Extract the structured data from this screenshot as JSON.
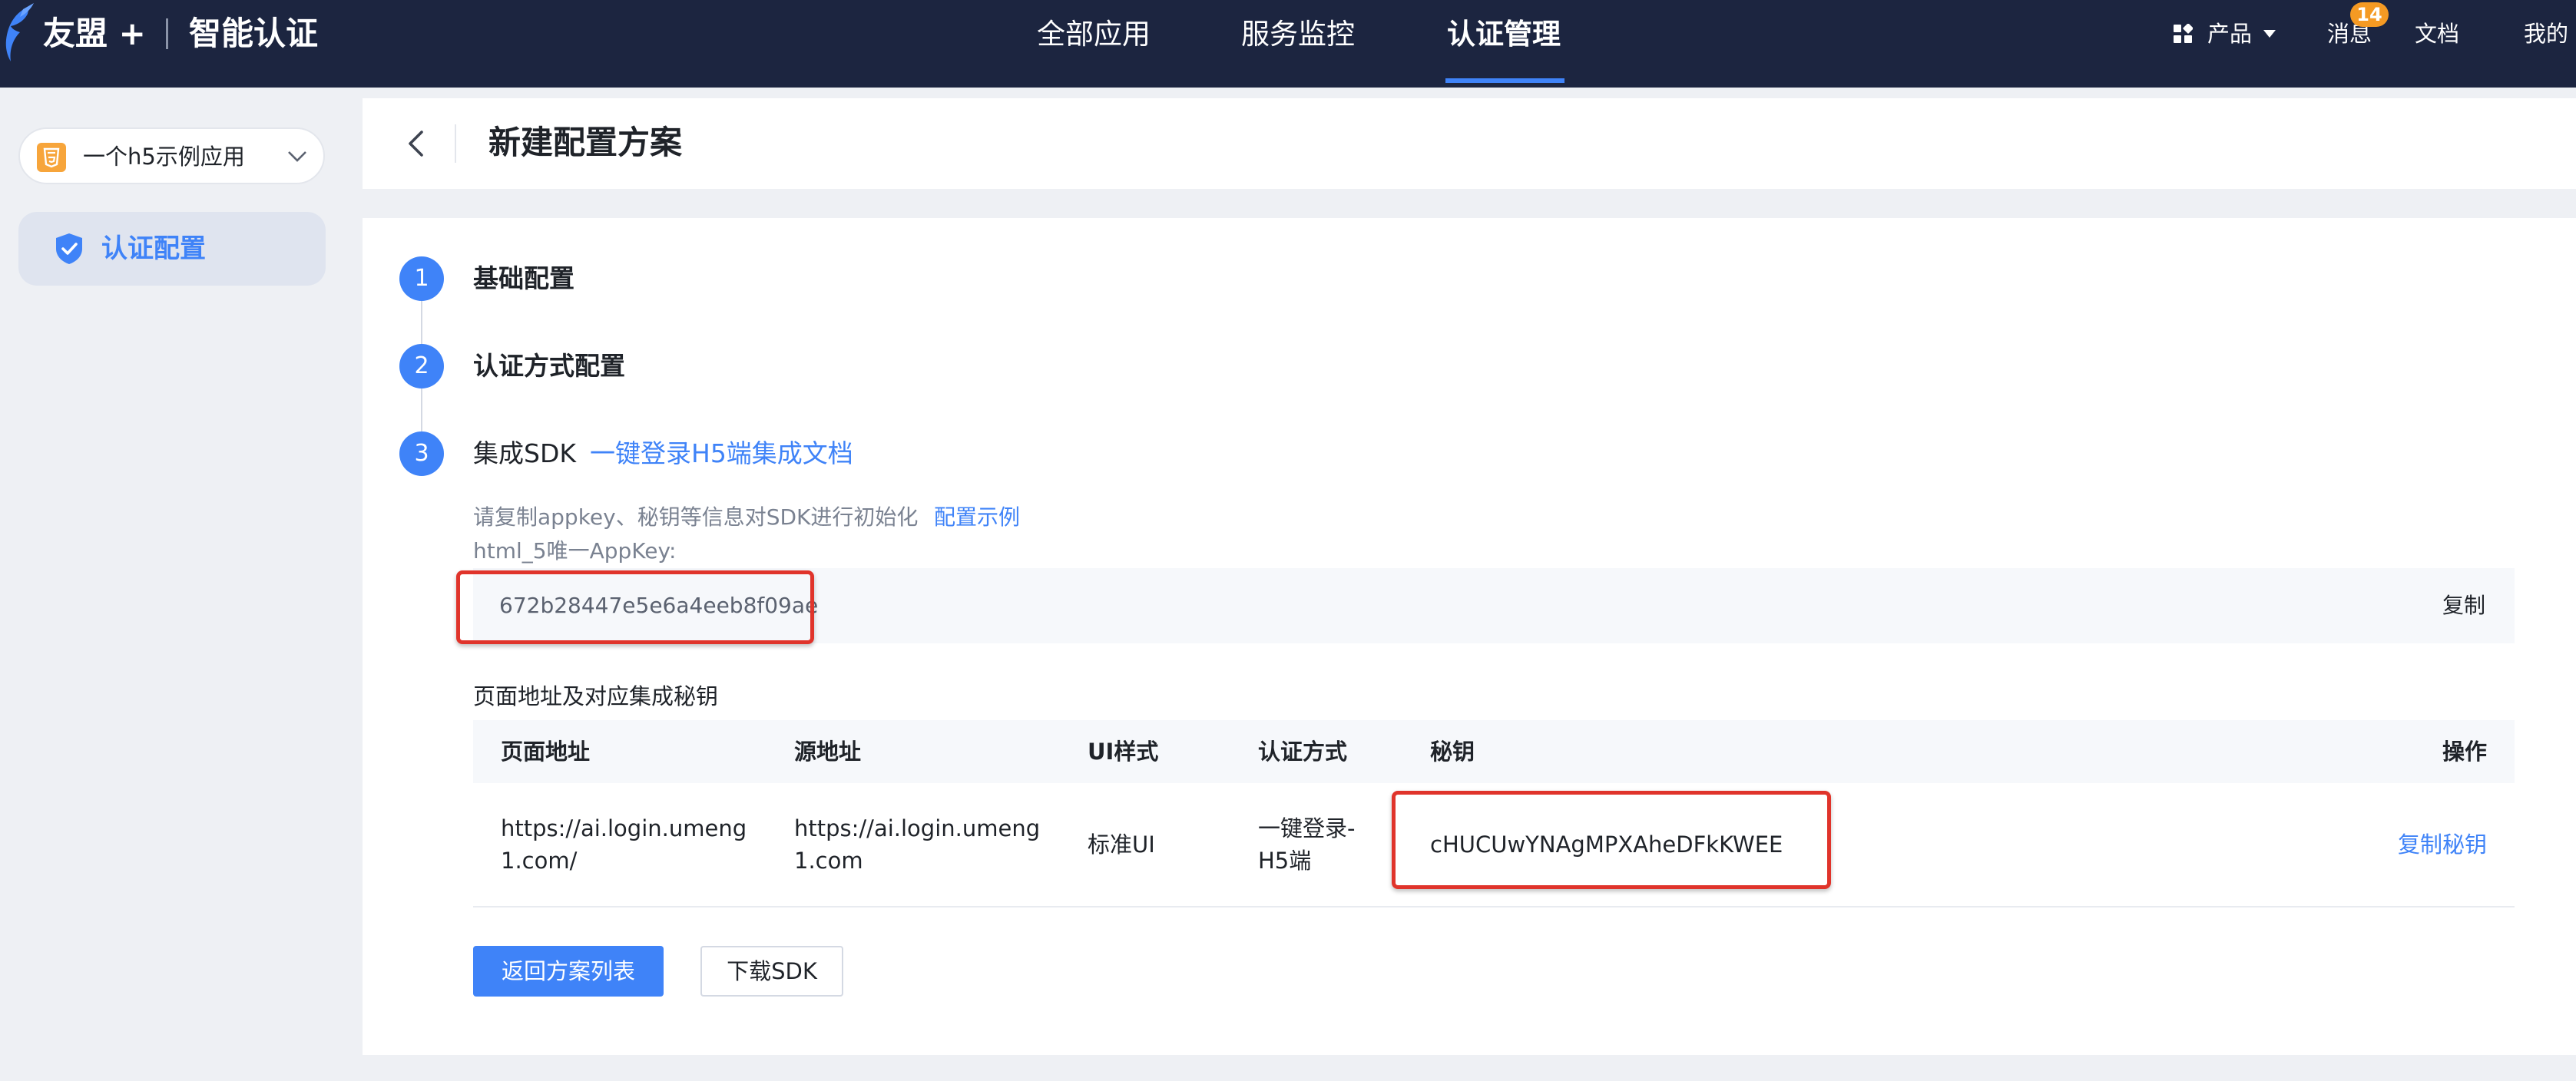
{
  "topnav": {
    "brand": "友盟 +",
    "product": "智能认证",
    "main_items": [
      {
        "label": "全部应用"
      },
      {
        "label": "服务监控"
      },
      {
        "label": "认证管理"
      }
    ],
    "util": {
      "product_label": "产品",
      "messages_label": "消息",
      "messages_badge": "14",
      "docs_label": "文档",
      "mine_label": "我的"
    }
  },
  "sidebar": {
    "app_select_value": "一个h5示例应用",
    "items": [
      {
        "label": "认证配置"
      }
    ]
  },
  "header": {
    "title": "新建配置方案"
  },
  "steps": [
    {
      "number": "1",
      "title": "基础配置"
    },
    {
      "number": "2",
      "title": "认证方式配置"
    },
    {
      "number": "3",
      "title": "集成SDK",
      "link": "一键登录H5端集成文档"
    }
  ],
  "sdk": {
    "hint": "请复制appkey、秘钥等信息对SDK进行初始化",
    "hint_link": "配置示例",
    "appkey_label": "html_5唯一AppKey:",
    "appkey_value": "672b28447e5e6a4eeb8f09ae",
    "copy_label": "复制",
    "section_label": "页面地址及对应集成秘钥",
    "table": {
      "headers": [
        "页面地址",
        "源地址",
        "UI样式",
        "认证方式",
        "秘钥",
        "操作"
      ],
      "rows": [
        {
          "page_url": "https://ai.login.umeng1.com/",
          "source_url": "https://ai.login.umeng1.com",
          "ui_style": "标准UI",
          "auth_method": "一键登录-H5端",
          "secret": "cHUCUwYNAgMPXAheDFkKWEE",
          "action": "复制秘钥"
        }
      ]
    }
  },
  "buttons": {
    "back_to_list": "返回方案列表",
    "download_sdk": "下载SDK"
  },
  "colors": {
    "nav_bg": "#1c2540",
    "accent": "#3f83f8",
    "highlight": "#e0342b",
    "badge": "#f59a23"
  }
}
